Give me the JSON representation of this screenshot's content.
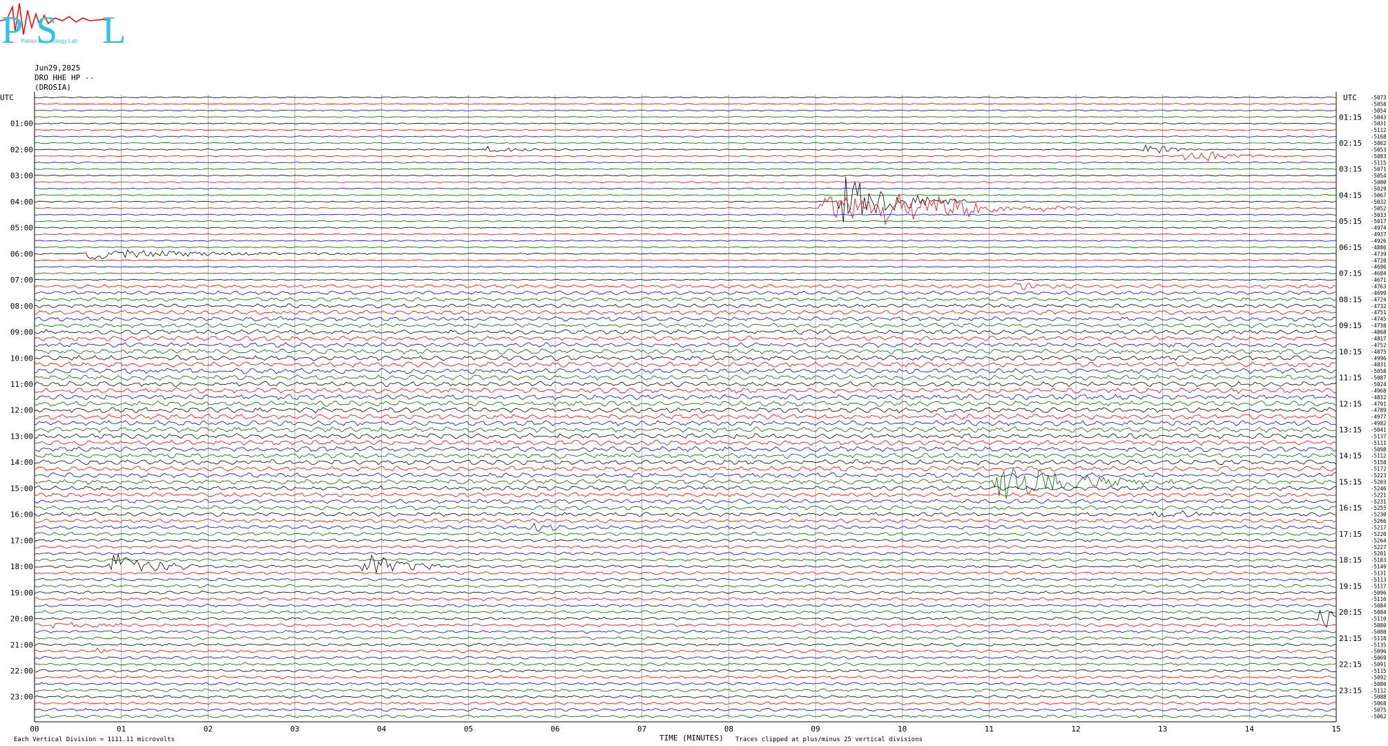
{
  "header": {
    "logo_text": "PSL",
    "logo_subtext": "Patras Seismology Lab",
    "date": "Jun29,2025",
    "station": "DRO HHE HP --",
    "location": "(DROSIA)"
  },
  "colors": {
    "trace_cycle": [
      "#000000",
      "#ff0000",
      "#0000ff",
      "#006400"
    ],
    "logo_blue": "#33c0e8",
    "logo_red": "#ff0000"
  },
  "chart_data": {
    "type": "seismogram",
    "xlabel": "TIME (MINUTES)",
    "xlim": [
      0,
      15
    ],
    "x_ticks": [
      "00",
      "01",
      "02",
      "03",
      "04",
      "05",
      "06",
      "07",
      "08",
      "09",
      "10",
      "11",
      "12",
      "13",
      "14",
      "15"
    ],
    "left_axis_title": "UTC",
    "right_axis_title": "UTC",
    "left_hour_labels": [
      "01:00",
      "02:00",
      "03:00",
      "04:00",
      "05:00",
      "06:00",
      "07:00",
      "08:00",
      "09:00",
      "10:00",
      "11:00",
      "12:00",
      "13:00",
      "14:00",
      "15:00",
      "16:00",
      "17:00",
      "18:00",
      "19:00",
      "20:00",
      "21:00",
      "22:00",
      "23:00"
    ],
    "right_hour_labels": [
      "01:15",
      "02:15",
      "03:15",
      "04:15",
      "05:15",
      "06:15",
      "07:15",
      "08:15",
      "09:15",
      "10:15",
      "11:15",
      "12:15",
      "13:15",
      "14:15",
      "15:15",
      "16:15",
      "17:15",
      "18:15",
      "19:15",
      "20:15",
      "21:15",
      "22:15",
      "23:15"
    ],
    "trace_count": 96,
    "minutes_per_trace": 15,
    "trace_offsets": [
      "-5073",
      "-5058",
      "-5054",
      "-5043",
      "-5031",
      "-5112",
      "-5168",
      "-5062",
      "-5053",
      "-5083",
      "-5115",
      "-5071",
      "-5054",
      "-5080",
      "-5029",
      "-5067",
      "-5032",
      "-5052",
      "-5033",
      "-5017",
      "-4974",
      "-4937",
      "-4926",
      "-4886",
      "-4739",
      "-4720",
      "-4696",
      "-4684",
      "-4671",
      "-4763",
      "-4699",
      "-4724",
      "-4732",
      "-4751",
      "-4745",
      "-4738",
      "-4868",
      "-4817",
      "-4752",
      "-4875",
      "-4996",
      "-4831",
      "-5058",
      "-5087",
      "-5024",
      "-4968",
      "-4832",
      "-4791",
      "-4789",
      "-4977",
      "-4982",
      "-5041",
      "-5137",
      "-5111",
      "-5098",
      "-5112",
      "-5158",
      "-5172",
      "-5223",
      "-5203",
      "-5246",
      "-5221",
      "-5231",
      "-5255",
      "-5230",
      "-5266",
      "-5217",
      "-5220",
      "-5264",
      "-5227",
      "-5201",
      "-5183",
      "-5149",
      "-5131",
      "-5113",
      "-5117",
      "-5096",
      "-5116",
      "-5084",
      "-5084",
      "-5110",
      "-5080",
      "-5080",
      "-5118",
      "-5135",
      "-5096",
      "-5069",
      "-5091",
      "-5115",
      "-5092",
      "-5086",
      "-5112",
      "-5088",
      "-5068",
      "-5075",
      "-5062"
    ],
    "events": [
      {
        "trace": 8,
        "minute": 5.2,
        "amp": 6,
        "dur": 0.4
      },
      {
        "trace": 8,
        "minute": 12.8,
        "amp": 10,
        "dur": 0.25
      },
      {
        "trace": 9,
        "minute": 13.2,
        "amp": 12,
        "dur": 0.5
      },
      {
        "trace": 16,
        "minute": 9.3,
        "amp": 40,
        "dur": 0.6
      },
      {
        "trace": 17,
        "minute": 9.1,
        "amp": 20,
        "dur": 1.2
      },
      {
        "trace": 17,
        "minute": 9.8,
        "amp": 18,
        "dur": 0.8
      },
      {
        "trace": 17,
        "minute": 10.3,
        "amp": 12,
        "dur": 0.6
      },
      {
        "trace": 24,
        "minute": 0.6,
        "amp": 8,
        "dur": 1.4
      },
      {
        "trace": 29,
        "minute": 11.3,
        "amp": 8,
        "dur": 0.3
      },
      {
        "trace": 42,
        "minute": 1.3,
        "amp": 4,
        "dur": 0.6
      },
      {
        "trace": 59,
        "minute": 11.1,
        "amp": 30,
        "dur": 0.8
      },
      {
        "trace": 64,
        "minute": 12.9,
        "amp": 6,
        "dur": 0.5
      },
      {
        "trace": 66,
        "minute": 5.7,
        "amp": 8,
        "dur": 0.2
      },
      {
        "trace": 72,
        "minute": 0.9,
        "amp": 24,
        "dur": 0.4
      },
      {
        "trace": 72,
        "minute": 3.8,
        "amp": 22,
        "dur": 0.4
      },
      {
        "trace": 80,
        "minute": 14.8,
        "amp": 18,
        "dur": 0.6
      },
      {
        "trace": 81,
        "minute": 0.2,
        "amp": 5,
        "dur": 0.6
      },
      {
        "trace": 81,
        "minute": 3.9,
        "amp": 4,
        "dur": 0.2
      },
      {
        "trace": 85,
        "minute": 0.7,
        "amp": 5,
        "dur": 0.2
      }
    ]
  },
  "footer": {
    "scale_note": "Each Vertical Division = 1111.11 microvolts",
    "clip_note": "Traces clipped at plus/minus 25 vertical divisions"
  }
}
